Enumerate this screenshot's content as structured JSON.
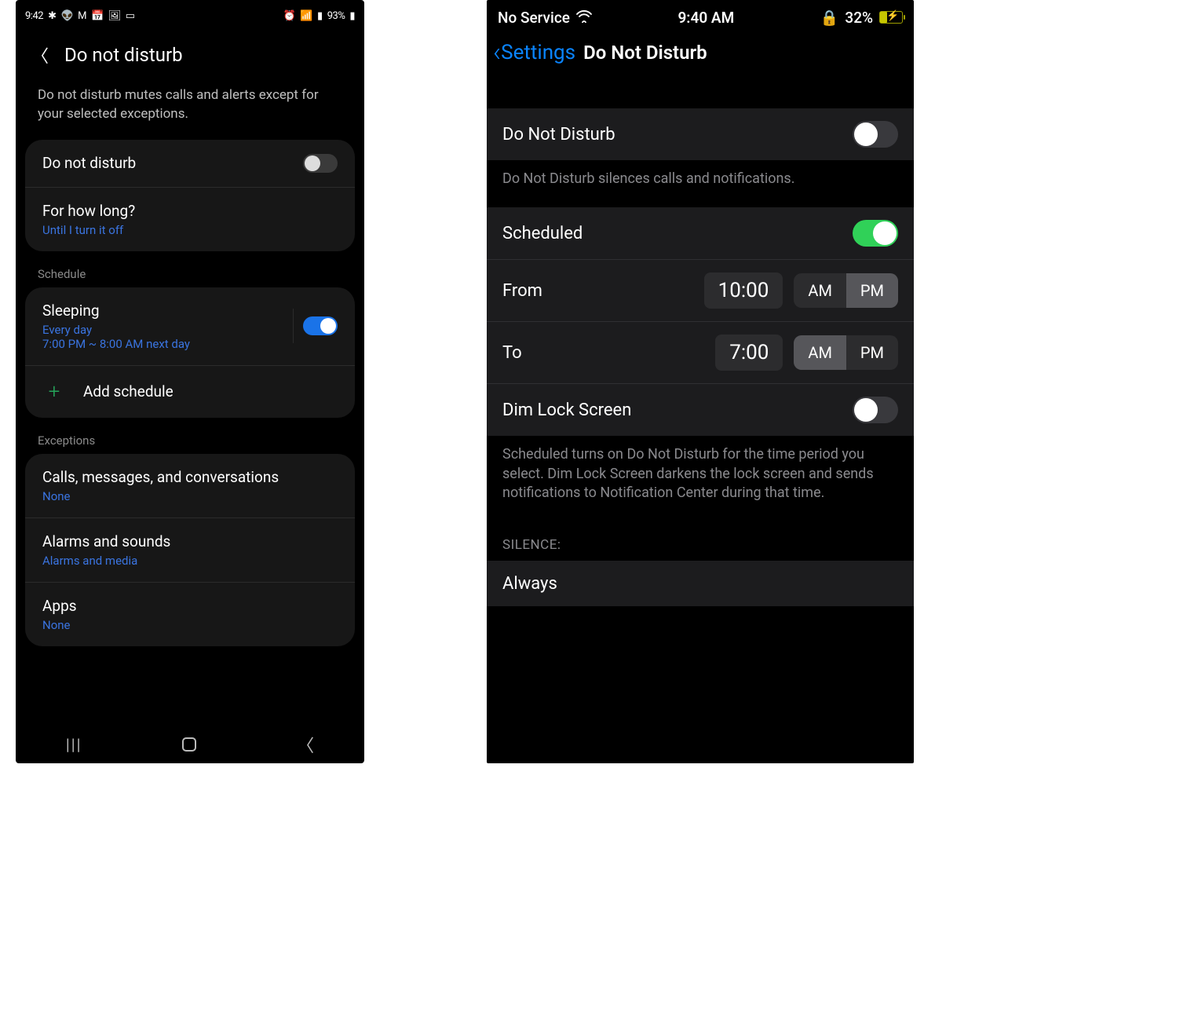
{
  "android": {
    "statusbar": {
      "time": "9:42",
      "battery": "93%"
    },
    "header": {
      "title": "Do not disturb"
    },
    "description": "Do not disturb mutes calls and alerts except for your selected exceptions.",
    "main_toggle": {
      "label": "Do not disturb",
      "on": false
    },
    "how_long": {
      "label": "For how long?",
      "value": "Until I turn it off"
    },
    "schedule_header": "Schedule",
    "sleeping": {
      "title": "Sleeping",
      "line1": "Every day",
      "line2": "7:00 PM ~ 8:00 AM next day",
      "on": true
    },
    "add_schedule": "Add schedule",
    "exceptions_header": "Exceptions",
    "exceptions": [
      {
        "title": "Calls, messages, and conversations",
        "value": "None"
      },
      {
        "title": "Alarms and sounds",
        "value": "Alarms and media"
      },
      {
        "title": "Apps",
        "value": "None"
      }
    ]
  },
  "ios": {
    "statusbar": {
      "service": "No Service",
      "time": "9:40 AM",
      "battery": "32%"
    },
    "nav": {
      "back": "Settings",
      "title": "Do Not Disturb"
    },
    "dnd": {
      "label": "Do Not Disturb",
      "on": false
    },
    "dnd_footer": "Do Not Disturb silences calls and notifications.",
    "scheduled": {
      "label": "Scheduled",
      "on": true
    },
    "from": {
      "label": "From",
      "time": "10:00",
      "am": "AM",
      "pm": "PM",
      "selected": "PM"
    },
    "to": {
      "label": "To",
      "time": "7:00",
      "am": "AM",
      "pm": "PM",
      "selected": "AM"
    },
    "dim": {
      "label": "Dim Lock Screen",
      "on": false
    },
    "sched_footer": "Scheduled turns on Do Not Disturb for the time period you select. Dim Lock Screen darkens the lock screen and sends notifications to Notification Center during that time.",
    "silence_header": "SILENCE:",
    "silence_always": "Always"
  }
}
